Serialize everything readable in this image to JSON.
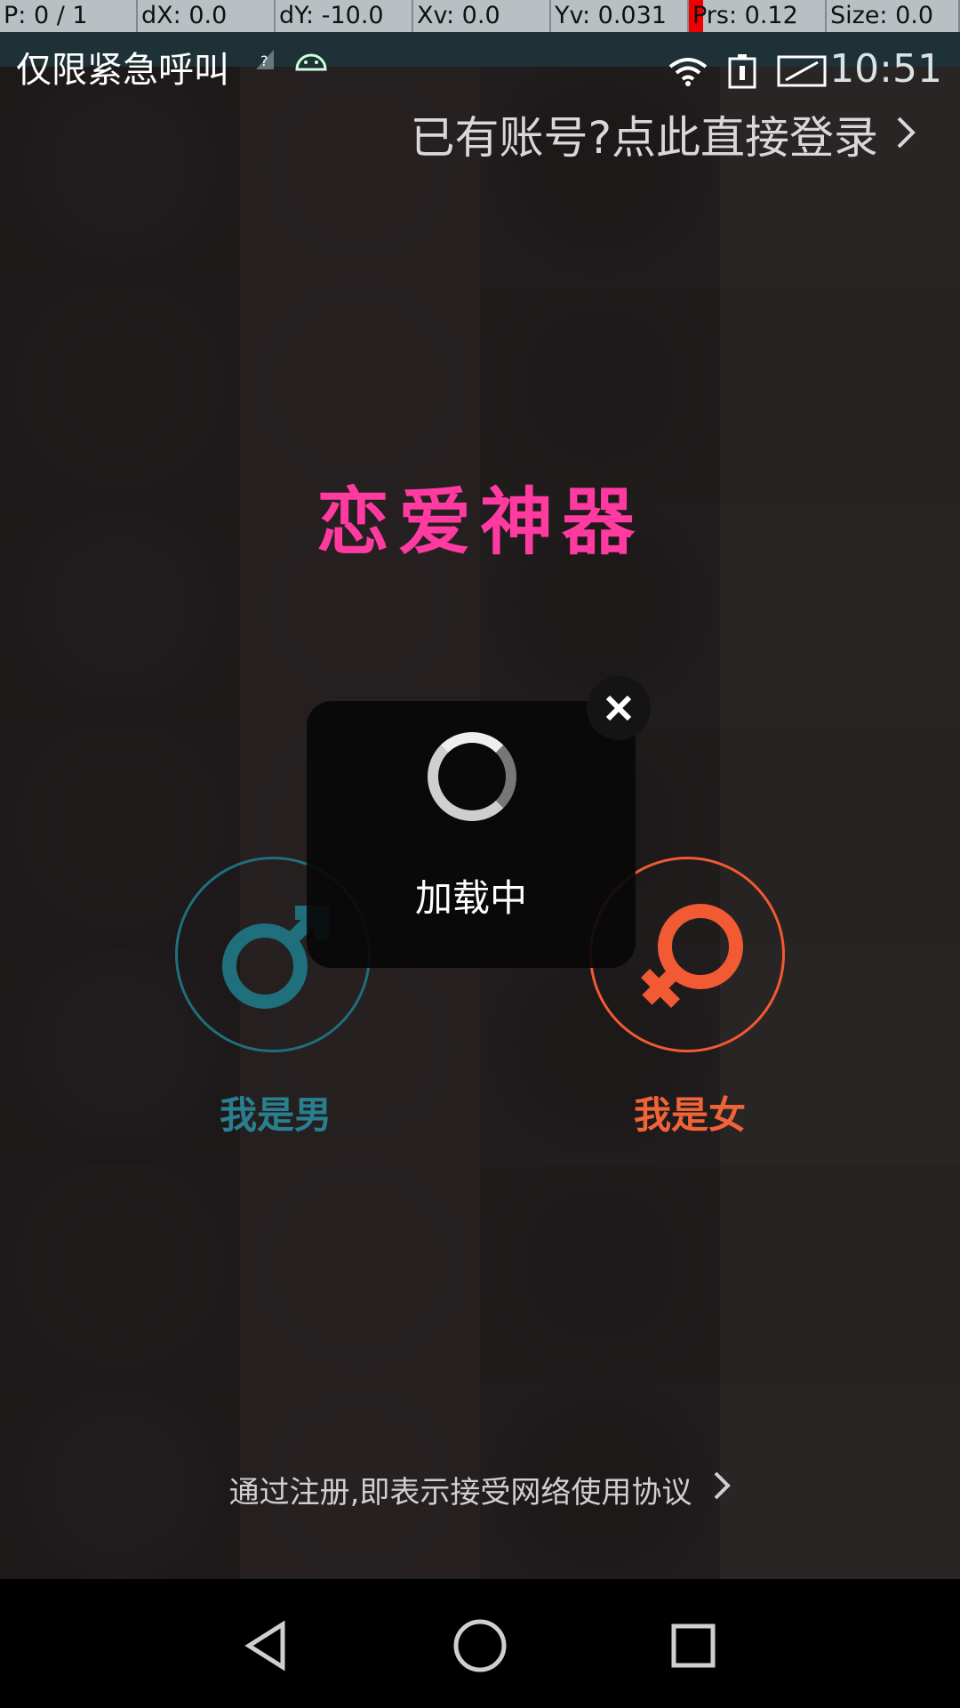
{
  "debug": {
    "cells": [
      "P: 0 / 1",
      "dX: 0.0",
      "dY: -10.0",
      "Xv: 0.0",
      "Yv: 0.031",
      "Prs: 0.12",
      "Size: 0.0"
    ]
  },
  "status_bar": {
    "title": "仅限紧急呼叫",
    "time": "10:51",
    "icons": [
      "unknown-sim-icon",
      "android-icon",
      "wifi-icon",
      "battery-icon",
      "screen-mirror-icon"
    ]
  },
  "header": {
    "login_link": "已有账号?点此直接登录"
  },
  "main": {
    "app_title": "恋爱神器",
    "male_label": "我是男",
    "female_label": "我是女",
    "accent_male": "#2a7f8e",
    "accent_female": "#f06437",
    "title_color": "#ff3aa0"
  },
  "loading": {
    "text": "加载中"
  },
  "footer": {
    "agreement": "通过注册,即表示接受网络使用协议"
  },
  "nav": {
    "icons": [
      "back-icon",
      "home-icon",
      "recents-icon"
    ]
  }
}
